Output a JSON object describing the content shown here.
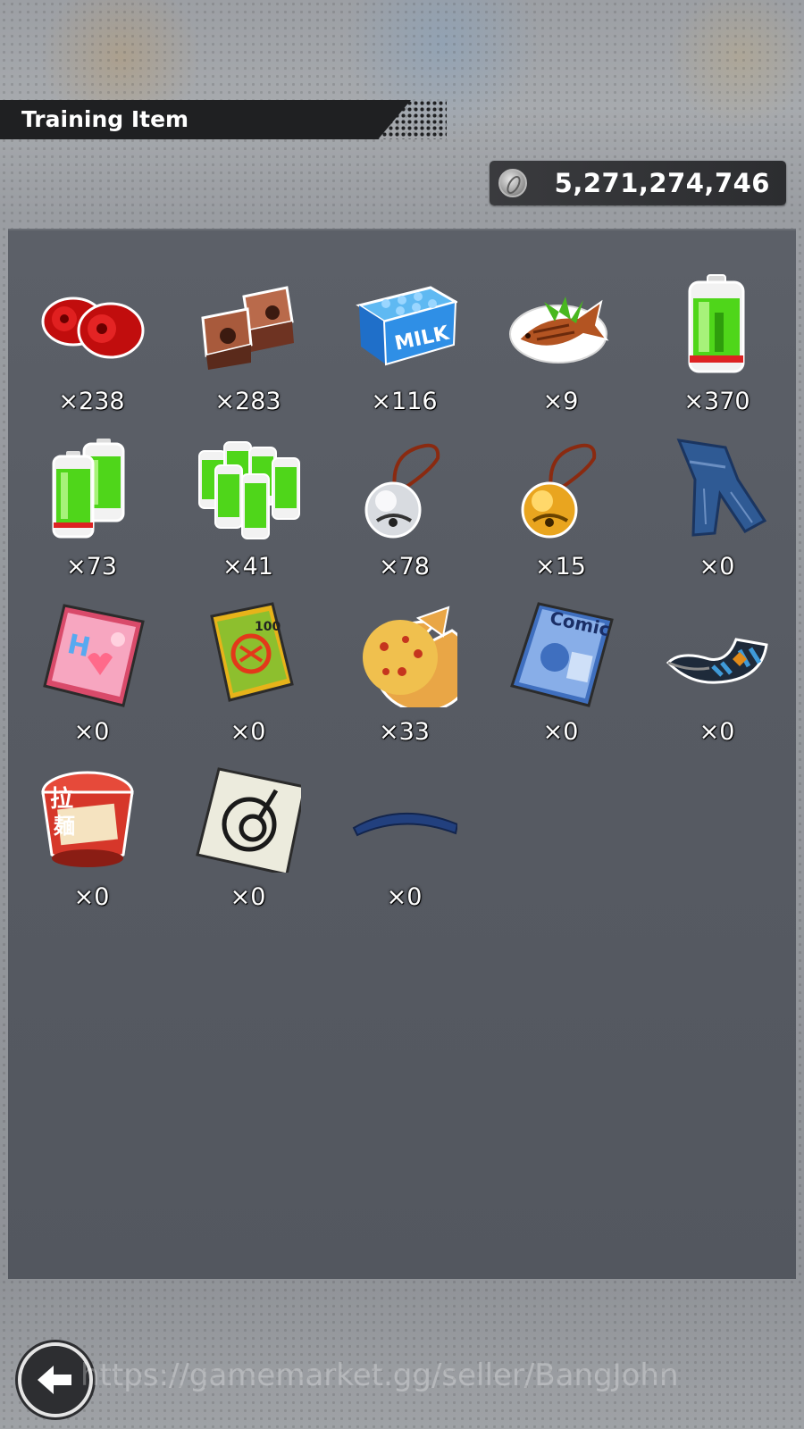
{
  "header": {
    "title": "Training Item"
  },
  "currency": {
    "icon": "zeni-coin-icon",
    "value": "5,271,274,746"
  },
  "items": [
    {
      "icon": "red-weights-icon",
      "count": "×238"
    },
    {
      "icon": "brick-weights-icon",
      "count": "×283"
    },
    {
      "icon": "milk-carton-icon",
      "count": "×116"
    },
    {
      "icon": "grilled-fish-icon",
      "count": "×9"
    },
    {
      "icon": "battery-icon",
      "count": "×370"
    },
    {
      "icon": "double-battery-icon",
      "count": "×73"
    },
    {
      "icon": "battery-pack-icon",
      "count": "×41"
    },
    {
      "icon": "silver-bell-icon",
      "count": "×78"
    },
    {
      "icon": "gold-bell-icon",
      "count": "×15"
    },
    {
      "icon": "jeans-icon",
      "count": "×0"
    },
    {
      "icon": "magazine-icon",
      "count": "×0"
    },
    {
      "icon": "manga-book-icon",
      "count": "×0"
    },
    {
      "icon": "pizza-icon",
      "count": "×33"
    },
    {
      "icon": "comic-book-icon",
      "count": "×0"
    },
    {
      "icon": "wristband-icon",
      "count": "×0"
    },
    {
      "icon": "instant-noodles-icon",
      "count": "×0"
    },
    {
      "icon": "emblem-card-icon",
      "count": "×0"
    },
    {
      "icon": "blue-headband-icon",
      "count": "×0"
    }
  ],
  "footer": {
    "back_icon": "back-arrow-icon",
    "watermark": "https://gamemarket.gg/seller/BangJohn"
  }
}
